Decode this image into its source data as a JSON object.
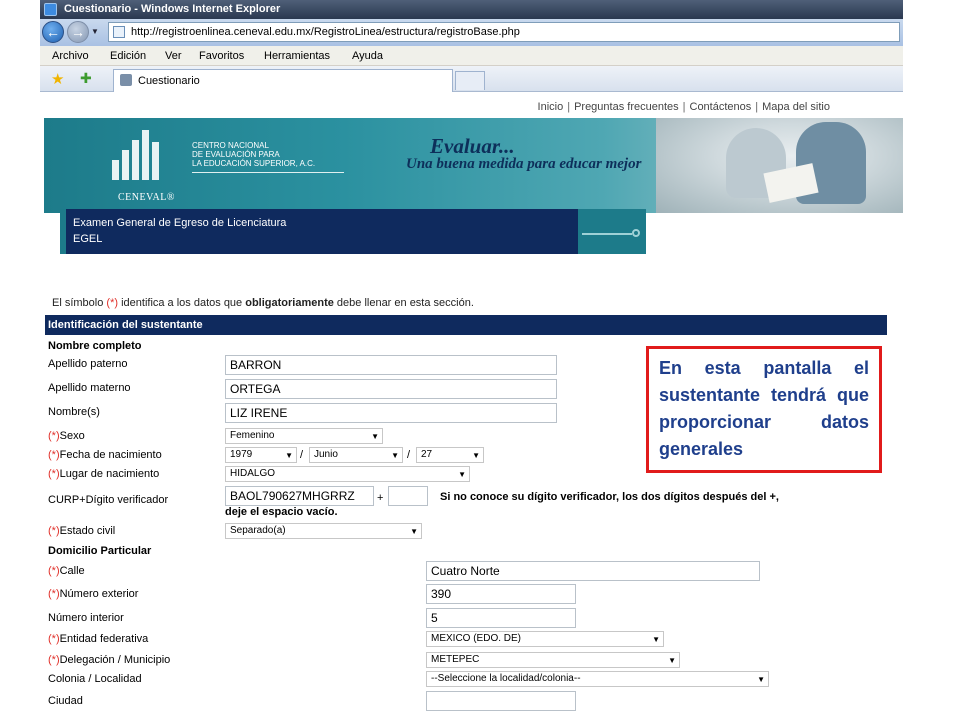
{
  "window": {
    "title": "Cuestionario - Windows Internet Explorer",
    "url": "http://registroenlinea.ceneval.edu.mx/RegistroLinea/estructura/registroBase.php"
  },
  "menubar": [
    "Archivo",
    "Edición",
    "Ver",
    "Favoritos",
    "Herramientas",
    "Ayuda"
  ],
  "tabs": {
    "active_label": "Cuestionario"
  },
  "toplinks": [
    "Inicio",
    "Preguntas frecuentes",
    "Contáctenos",
    "Mapa del sitio"
  ],
  "banner": {
    "org_lines": [
      "CENTRO NACIONAL",
      "DE EVALUACIÓN PARA",
      "LA EDUCACIÓN SUPERIOR, A.C."
    ],
    "brand": "CENEVAL®",
    "slogan_line1": "Evaluar...",
    "slogan_line2": "Una buena medida para educar mejor"
  },
  "exam": {
    "name": "Examen General de Egreso de Licenciatura",
    "code": "EGEL"
  },
  "instructions": {
    "before": "El símbolo ",
    "marker": "(*)",
    "middle": " identifica a los datos que ",
    "bold": "obligatoriamente",
    "after": " debe llenar en esta sección."
  },
  "section_title": "Identificación del sustentante",
  "nombre_completo": {
    "heading": "Nombre completo",
    "apellido_paterno": {
      "label": "Apellido paterno",
      "value": "BARRON"
    },
    "apellido_materno": {
      "label": "Apellido materno",
      "value": "ORTEGA"
    },
    "nombres": {
      "label": "Nombre(s)",
      "value": "LIZ IRENE"
    },
    "sexo": {
      "req": "(*)",
      "label": "Sexo",
      "value": "Femenino"
    },
    "fecha_nacimiento": {
      "req": "(*)",
      "label": "Fecha de nacimiento",
      "year": "1979",
      "month": "Junio",
      "day": "27",
      "separator": "/"
    },
    "lugar_nacimiento": {
      "req": "(*)",
      "label": "Lugar de nacimiento",
      "value": "HIDALGO"
    },
    "curp": {
      "label": "CURP+Dígito verificador",
      "value": "BAOL790627MHGRRZ",
      "plus": "+",
      "digit": "",
      "note_line1": "Si no conoce su dígito verificador, los dos dígitos después del +,",
      "note_line2": "deje el espacio vacío."
    },
    "estado_civil": {
      "req": "(*)",
      "label": "Estado civil",
      "value": "Separado(a)"
    }
  },
  "domicilio": {
    "heading": "Domicilio Particular",
    "calle": {
      "req": "(*)",
      "label": "Calle",
      "value": "Cuatro Norte"
    },
    "numero_exterior": {
      "req": "(*)",
      "label": "Número exterior",
      "value": "390"
    },
    "numero_interior": {
      "label": "Número interior",
      "value": "5"
    },
    "entidad": {
      "req": "(*)",
      "label": "Entidad federativa",
      "value": "MEXICO (EDO. DE)"
    },
    "delegacion": {
      "req": "(*)",
      "label": "Delegación / Municipio",
      "value": "METEPEC"
    },
    "colonia": {
      "label": "Colonia / Localidad",
      "value": "--Seleccione la localidad/colonia--"
    },
    "ciudad": {
      "label": "Ciudad",
      "value": ""
    }
  },
  "callout": "En esta pantalla el sustentante tendrá que proporcionar datos generales",
  "colors": {
    "title_bar": "#2a3850",
    "banner_teal": "#1d7b8a",
    "navy": "#0f2a5e",
    "required_red": "#e0302a",
    "callout_border": "#e11b1b",
    "callout_text": "#1f3f8c"
  }
}
